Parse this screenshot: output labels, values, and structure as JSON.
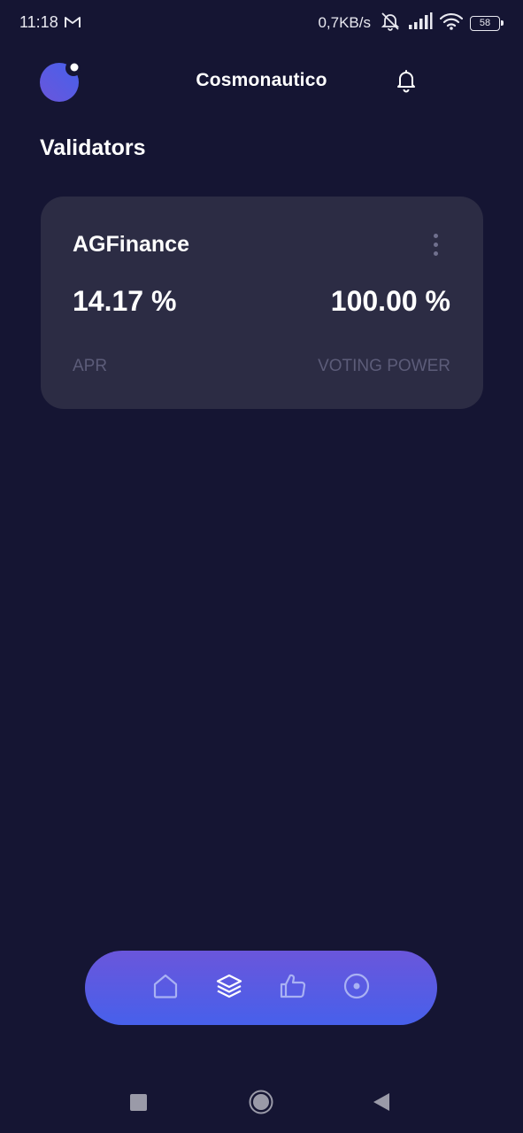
{
  "status_bar": {
    "time": "11:18",
    "net_speed": "0,7KB/s",
    "battery_level": "58",
    "icons": [
      "gmail-icon",
      "mute-icon",
      "signal-icon",
      "wifi-icon",
      "battery-icon"
    ]
  },
  "header": {
    "title": "Cosmonautico",
    "icons": [
      "logo-icon",
      "bell-icon"
    ]
  },
  "page": {
    "title": "Validators"
  },
  "validators": [
    {
      "name": "AGFinance",
      "apr": "14.17 %",
      "apr_label": "APR",
      "voting_power": "100.00 %",
      "voting_power_label": "VOTING POWER"
    }
  ],
  "bottom_nav": {
    "items": [
      "home-icon",
      "layers-icon",
      "thumbs-up-icon",
      "target-icon"
    ],
    "active": "layers-icon"
  },
  "system_nav": {
    "items": [
      "recents-icon",
      "home-circle-icon",
      "back-icon"
    ]
  },
  "colors": {
    "background": "#151533",
    "card": "#2c2c44",
    "muted_text": "#5c5c79",
    "nav_gradient_top": "#6a56db",
    "nav_gradient_bottom": "#4760eb"
  }
}
